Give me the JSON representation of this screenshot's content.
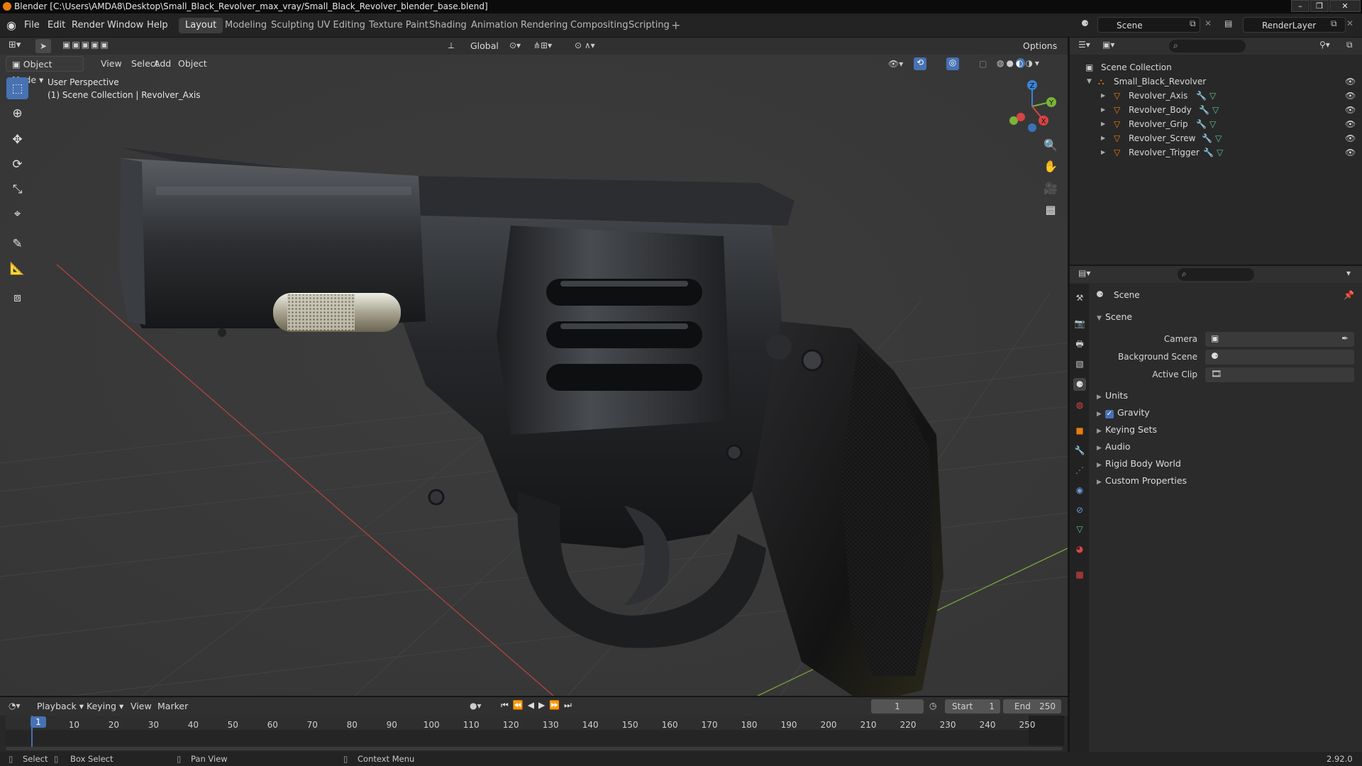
{
  "window": {
    "title": "Blender [C:\\Users\\AMDA8\\Desktop\\Small_Black_Revolver_max_vray/Small_Black_Revolver_blender_base.blend]"
  },
  "menu": [
    "File",
    "Edit",
    "Render",
    "Window",
    "Help"
  ],
  "workspaces": [
    "Layout",
    "Modeling",
    "Sculpting",
    "UV Editing",
    "Texture Paint",
    "Shading",
    "Animation",
    "Rendering",
    "Compositing",
    "Scripting"
  ],
  "active_workspace": "Layout",
  "scene_field": "Scene",
  "layer_field": "RenderLayer",
  "viewport": {
    "mode": "Object Mode",
    "menus": [
      "View",
      "Select",
      "Add",
      "Object"
    ],
    "transform": "Global",
    "options": "Options",
    "overlay_title": "User Perspective",
    "overlay_sub": "(1) Scene Collection | Revolver_Axis",
    "gizmo": {
      "z": "Z",
      "y": "Y",
      "x": "X"
    }
  },
  "outliner": {
    "root": "Scene Collection",
    "collection": "Small_Black_Revolver",
    "objects": [
      "Revolver_Axis",
      "Revolver_Body",
      "Revolver_Grip",
      "Revolver_Screw",
      "Revolver_Trigger"
    ]
  },
  "properties": {
    "context": "Scene",
    "panel": "Scene",
    "fields": [
      {
        "label": "Camera"
      },
      {
        "label": "Background Scene"
      },
      {
        "label": "Active Clip"
      }
    ],
    "sections": [
      "Units",
      "Gravity",
      "Keying Sets",
      "Audio",
      "Rigid Body World",
      "Custom Properties"
    ],
    "gravity_checked": true
  },
  "timeline": {
    "menus": [
      "Playback",
      "Keying",
      "View",
      "Marker"
    ],
    "current_frame": "1",
    "start_label": "Start",
    "start": "1",
    "end_label": "End",
    "end": "250",
    "ticks": [
      "1",
      "10",
      "20",
      "30",
      "40",
      "50",
      "60",
      "70",
      "80",
      "90",
      "100",
      "110",
      "120",
      "130",
      "140",
      "150",
      "160",
      "170",
      "180",
      "190",
      "200",
      "210",
      "220",
      "230",
      "240",
      "250"
    ]
  },
  "statusbar": {
    "select": "Select",
    "box_select": "Box Select",
    "pan_view": "Pan View",
    "context_menu": "Context Menu",
    "version": "2.92.0"
  },
  "colors": {
    "accent": "#4772b3",
    "orange": "#e87d0d",
    "x_axis": "#d84343",
    "y_axis": "#7bb338",
    "z_axis": "#3b82d9"
  }
}
